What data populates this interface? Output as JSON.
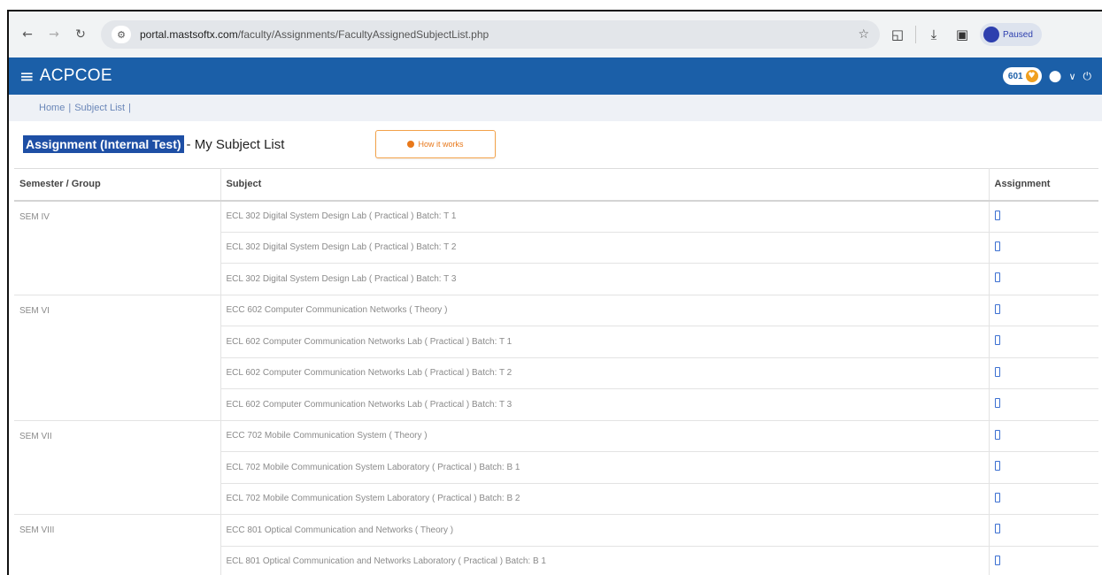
{
  "browser": {
    "url_host": "portal.mastsoftx.com",
    "url_path": "/faculty/Assignments/FacultyAssignedSubjectList.php",
    "profile_label": "Paused"
  },
  "app": {
    "brand": "ACPCOE",
    "notification_count": "601"
  },
  "breadcrumb": {
    "home": "Home",
    "sep": "|",
    "current": "Subject List",
    "trail_sep": "|"
  },
  "page": {
    "title_highlight": "Assignment (Internal Test)",
    "title_rest": "- My Subject List",
    "how_button": "How it works"
  },
  "table": {
    "headers": [
      "Semester / Group",
      "Subject",
      "Assignment"
    ],
    "rows": [
      {
        "sem": "SEM IV",
        "subject": "ECL 302 Digital System Design Lab ( Practical ) Batch: T 1"
      },
      {
        "sem": "",
        "subject": "ECL 302 Digital System Design Lab ( Practical ) Batch: T 2"
      },
      {
        "sem": "",
        "subject": "ECL 302 Digital System Design Lab ( Practical ) Batch: T 3"
      },
      {
        "sem": "SEM VI",
        "subject": "ECC 602 Computer Communication Networks ( Theory )"
      },
      {
        "sem": "",
        "subject": "ECL 602 Computer Communication Networks Lab ( Practical ) Batch: T 1"
      },
      {
        "sem": "",
        "subject": "ECL 602 Computer Communication Networks Lab ( Practical ) Batch: T 2"
      },
      {
        "sem": "",
        "subject": "ECL 602 Computer Communication Networks Lab ( Practical ) Batch: T 3"
      },
      {
        "sem": "SEM VII",
        "subject": "ECC 702 Mobile Communication System ( Theory )"
      },
      {
        "sem": "",
        "subject": "ECL 702 Mobile Communication System Laboratory ( Practical ) Batch: B 1"
      },
      {
        "sem": "",
        "subject": "ECL 702 Mobile Communication System Laboratory ( Practical ) Batch: B 2"
      },
      {
        "sem": "SEM VIII",
        "subject": "ECC 801 Optical Communication and Networks ( Theory )"
      },
      {
        "sem": "",
        "subject": "ECL 801 Optical Communication and Networks Laboratory ( Practical ) Batch: B 1"
      }
    ]
  },
  "colors": {
    "appbar": "#1b5fa8",
    "highlight": "#1e4fa5",
    "accent_orange": "#e8781a"
  },
  "icons": {
    "back": "arrow-left-icon",
    "forward": "arrow-right-icon",
    "reload": "reload-icon",
    "tune": "site-settings-icon",
    "star": "bookmark-star-icon",
    "menu": "hamburger-icon",
    "bell": "bell-icon",
    "user": "user-circle-icon",
    "assignment": "document-icon"
  }
}
